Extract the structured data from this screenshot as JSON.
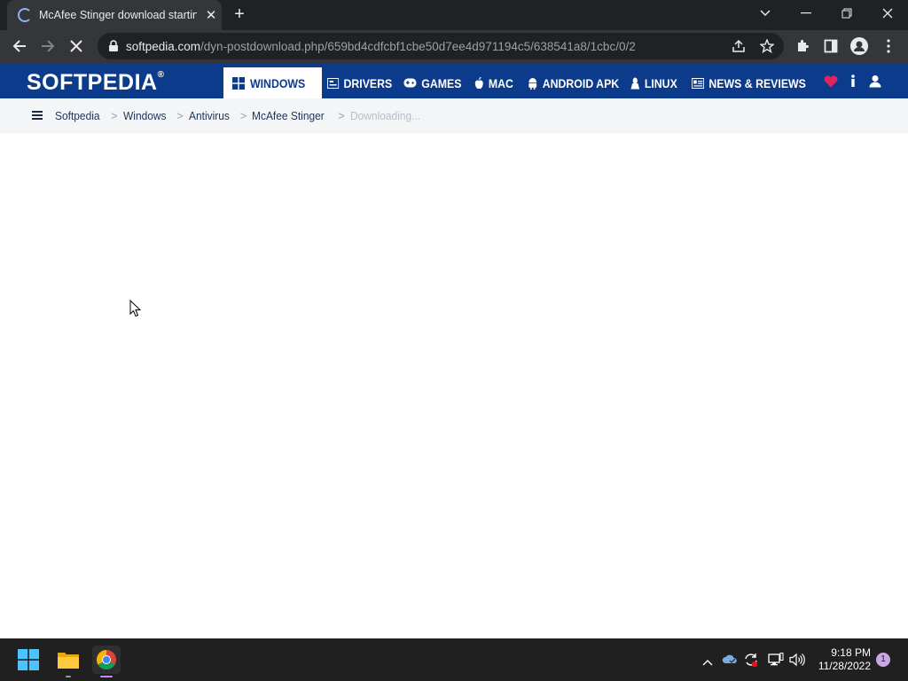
{
  "browser": {
    "tab_title": "McAfee Stinger download startin",
    "url_host": "softpedia.com",
    "url_path": "/dyn-postdownload.php/659bd4cdfcbf1cbe50d7ee4d971194c5/638541a8/1cbc/0/2"
  },
  "site": {
    "logo": "SOFTPEDIA",
    "logo_mark": "®",
    "nav": [
      {
        "label": "WINDOWS",
        "icon": "windows-icon"
      },
      {
        "label": "DRIVERS",
        "icon": "drivers-icon"
      },
      {
        "label": "GAMES",
        "icon": "gamepad-icon"
      },
      {
        "label": "MAC",
        "icon": "apple-icon"
      },
      {
        "label": "ANDROID APK",
        "icon": "android-icon"
      },
      {
        "label": "LINUX",
        "icon": "linux-icon"
      },
      {
        "label": "NEWS & REVIEWS",
        "icon": "news-icon"
      }
    ],
    "breadcrumb": [
      "Softpedia",
      "Windows",
      "Antivirus",
      "McAfee Stinger",
      "Downloading..."
    ],
    "breadcrumb_separator": ">"
  },
  "colors": {
    "brand_blue": "#0d3b8c",
    "heart": "#e0245e",
    "browser_dark": "#202124"
  },
  "taskbar": {
    "time": "9:18 PM",
    "date": "11/28/2022",
    "notification_count": "1"
  }
}
